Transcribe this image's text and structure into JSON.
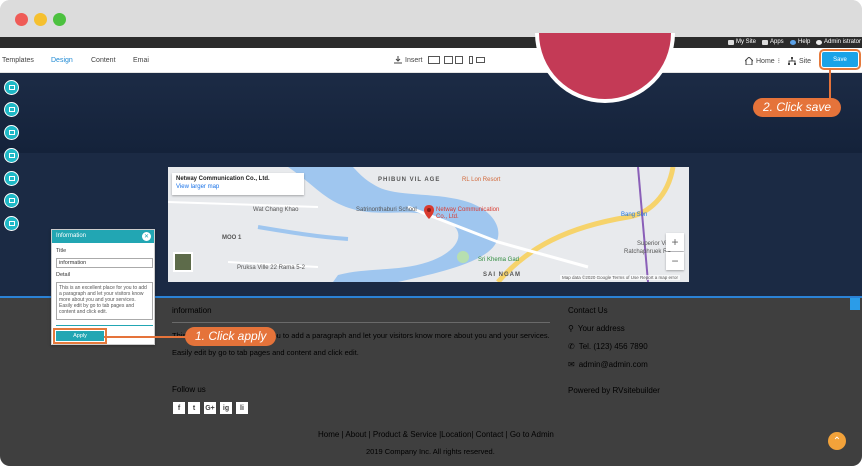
{
  "adminbar": {
    "my_site": "My Site",
    "apps": "Apps",
    "help": "Help",
    "admin": "Admin istrator"
  },
  "toolbar": {
    "tabs": [
      "Templates",
      "Design",
      "Content",
      "Emai"
    ],
    "active_tab": "Design",
    "insert": "Insert",
    "home": "Home",
    "site": "Site",
    "save": "Save"
  },
  "map": {
    "place_title": "Netway Communication Co., Ltd.",
    "view_larger": "View larger map",
    "pin_label_1": "Netway Communication",
    "pin_label_2": "Co., Ltd.",
    "labels": {
      "phibun": "PHIBUN VIL AGE",
      "satri": "Satrinonthaburi School",
      "wat_chang": "Wat Chang Khao",
      "moo": "MOO 1",
      "pruksa": "Pruksa Ville 22 Rama 5-2",
      "sri_khema": "Sri Khema Gad",
      "sai_ngam": "SAI NGAM",
      "bang_son": "Bang Son",
      "kapp": "Superior Vic",
      "racha": "Ratchaphruek Ra",
      "rlon": "RL Lon Resort"
    },
    "footer": "Map data ©2020 Google   Terms of Use   Report a map error"
  },
  "footer": {
    "info_title": "information",
    "info_text_1": "This is an excellent place for you to add a paragraph and let your visitors know more about you and your services.",
    "info_text_2": "Easily edit by go to tab pages and content and click edit.",
    "follow": "Follow us",
    "social": [
      "f",
      "t",
      "G+",
      "ig",
      "li"
    ],
    "contact_title": "Contact Us",
    "address": "Your address",
    "tel": "Tel. (123) 456 7890",
    "email": "admin@admin.com",
    "powered": "Powered by RVsitebuilder",
    "links": "Home | About | Product & Service |Location| Contact | Go to Admin",
    "copyright": "2019 Company Inc. All rights reserved."
  },
  "panel": {
    "title": "Information",
    "title_label": "Title",
    "title_value": "information",
    "detail_label": "Detail",
    "detail_value": "This is an excellent place for you to add a paragraph and let your visitors know more about you and your services. Easily edit by go to tab pages and content and click edit.",
    "apply": "Apply"
  },
  "callouts": {
    "save": "2. Click save",
    "apply": "1. Click apply"
  },
  "colors": {
    "accent": "#1aa3e8",
    "teal": "#22a6b3",
    "callout": "#e5733a",
    "footer_bg": "#3f3f3f"
  }
}
